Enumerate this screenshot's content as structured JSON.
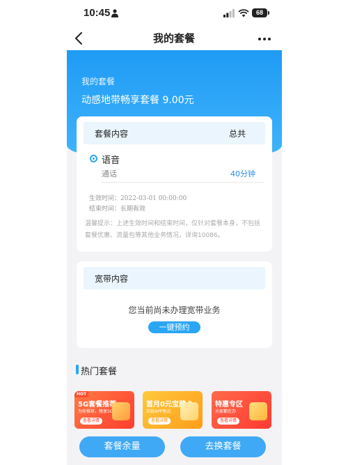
{
  "status_bar": {
    "time": "10:45",
    "battery": "68"
  },
  "nav": {
    "title": "我的套餐"
  },
  "header": {
    "subtitle": "我的套餐",
    "plan": "动感地带畅享套餐 9.00元"
  },
  "package_card": {
    "header_title": "套餐内容",
    "header_total": "总共",
    "voice_title": "语音",
    "call_label": "通话",
    "call_value": "40分钟",
    "effective_label": "生效时间：",
    "effective_value": "2022-03-01 00:00:00",
    "end_label": "结束时间：",
    "end_value": "长期有效",
    "notice": "温馨提示：上述生效时间和结束时间，仅针对套餐本身，不包括套餐优惠、流量包等其他业务情况，详询10086。"
  },
  "broadband_card": {
    "header_title": "宽带内容",
    "empty_text": "您当前尚未办理宽带业务",
    "book_label": "一键预约"
  },
  "hot": {
    "title": "热门套餐",
    "cards": [
      {
        "tag": "HOT",
        "title": "5G套餐推荐",
        "subtitle": "为你推荐，畅享5G",
        "button": "查看详情",
        "color": "#ff5a3c"
      },
      {
        "title": "首月0元宝藏卡",
        "subtitle": "百款APP免流",
        "button": "查看详情",
        "color": "#ffb21f"
      },
      {
        "title": "特惠专区",
        "subtitle": "大家都在办",
        "button": "查看详情",
        "color": "#ff5a3c"
      }
    ]
  },
  "bottom": {
    "balance_label": "套餐余量",
    "change_label": "去换套餐"
  },
  "colors": {
    "accent": "#2aa6f5",
    "header_top": "#1f9bf5",
    "header_bottom": "#3fb3fb"
  }
}
